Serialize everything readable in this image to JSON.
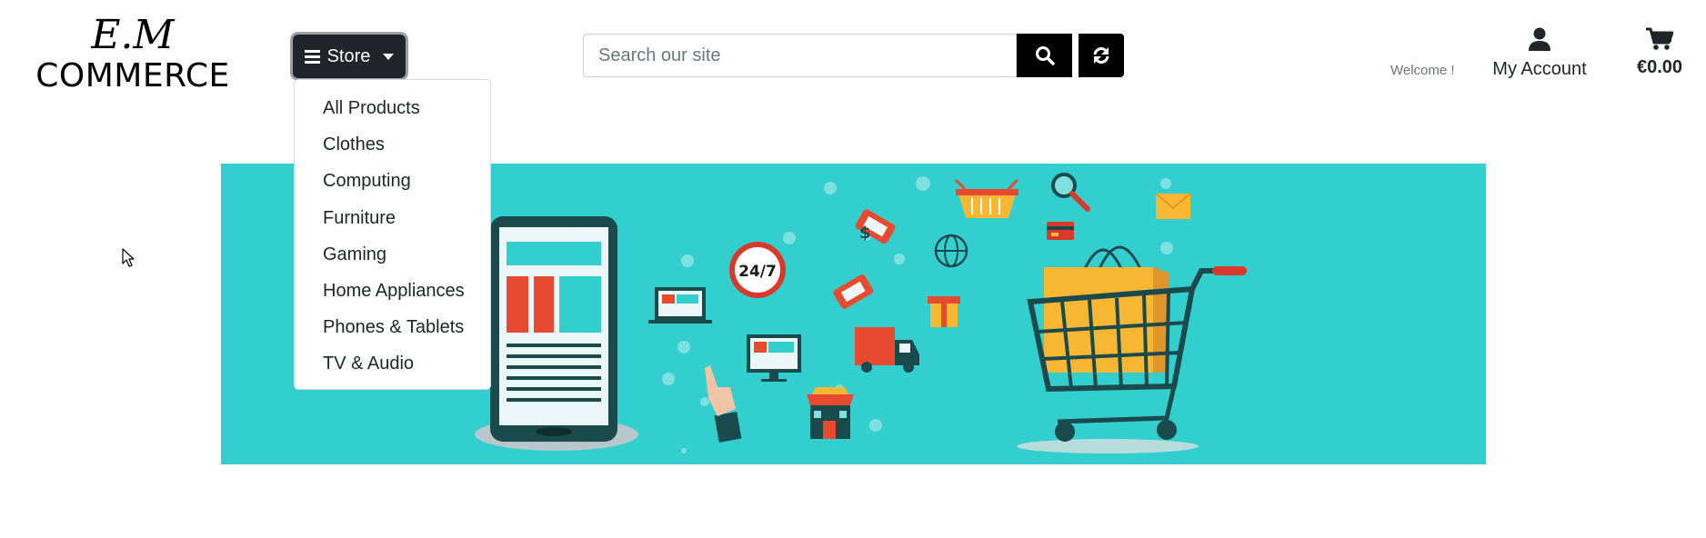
{
  "logo": {
    "line1": "E.M",
    "line2": "COMMERCE"
  },
  "store_button": {
    "label": "Store"
  },
  "store_menu": {
    "items": [
      "All Products",
      "Clothes",
      "Computing",
      "Furniture",
      "Gaming",
      "Home Appliances",
      "Phones & Tablets",
      "TV & Audio"
    ]
  },
  "search": {
    "placeholder": "Search our site",
    "value": ""
  },
  "header": {
    "welcome": "Welcome !",
    "account_label": "My Account",
    "cart_total": "€0.00"
  },
  "banner": {
    "clock_text": "24/7",
    "accent_color": "#33cfcf"
  },
  "icons": [
    "hamburger-icon",
    "caret-down-icon",
    "search-icon",
    "refresh-icon",
    "user-icon",
    "cart-icon",
    "mouse-cursor-icon"
  ]
}
